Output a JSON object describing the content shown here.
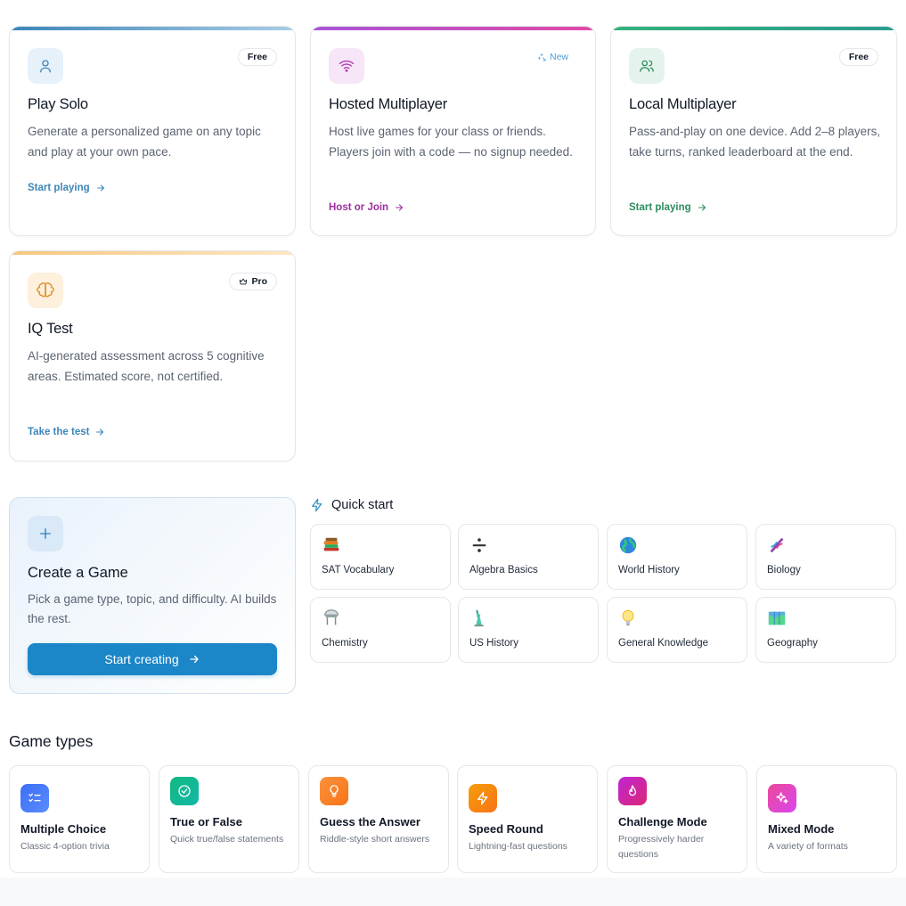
{
  "modes": [
    {
      "id": "play-solo",
      "title": "Play Solo",
      "badge": "Free",
      "desc": "Generate a personalized game on any topic and play at your own pace.",
      "link": "Start playing",
      "icon": "user-icon"
    },
    {
      "id": "hosted-multiplayer",
      "title": "Hosted Multiplayer",
      "badge": "New",
      "desc": "Host live games for your class or friends. Players join with a code — no signup needed.",
      "link": "Host or Join",
      "icon": "wifi-icon"
    },
    {
      "id": "local-multiplayer",
      "title": "Local Multiplayer",
      "badge": "Free",
      "desc": "Pass-and-play on one device. Add 2–8 players, take turns, ranked leaderboard at the end.",
      "link": "Start playing",
      "icon": "users-icon"
    },
    {
      "id": "iq-test",
      "title": "IQ Test",
      "badge": "Pro",
      "desc": "AI-generated assessment across 5 cognitive areas. Estimated score, not certified.",
      "link": "Take the test",
      "icon": "brain-icon"
    }
  ],
  "create": {
    "title": "Create a Game",
    "desc": "Pick a game type, topic, and difficulty. AI builds the rest.",
    "cta": "Start creating"
  },
  "quick_start": {
    "title": "Quick start",
    "items": [
      {
        "label": "SAT Vocabulary",
        "icon": "books-icon"
      },
      {
        "label": "Algebra Basics",
        "icon": "divide-icon"
      },
      {
        "label": "World History",
        "icon": "globe-icon"
      },
      {
        "label": "Biology",
        "icon": "dna-icon"
      },
      {
        "label": "Chemistry",
        "icon": "flask-icon"
      },
      {
        "label": "US History",
        "icon": "statue-of-liberty-icon"
      },
      {
        "label": "General Knowledge",
        "icon": "lightbulb-icon"
      },
      {
        "label": "Geography",
        "icon": "map-icon"
      }
    ]
  },
  "game_types": {
    "title": "Game types",
    "items": [
      {
        "name": "Multiple Choice",
        "sub": "Classic 4-option trivia",
        "icon": "list-check-icon",
        "color": "#3b6ef5"
      },
      {
        "name": "True or False",
        "sub": "Quick true/false statements",
        "icon": "check-circle-icon",
        "color": "#14b8a6"
      },
      {
        "name": "Guess the Answer",
        "sub": "Riddle-style short answers",
        "icon": "lightbulb-icon",
        "color": "#f97316"
      },
      {
        "name": "Speed Round",
        "sub": "Lightning-fast questions",
        "icon": "bolt-icon",
        "color": "#f5a524"
      },
      {
        "name": "Challenge Mode",
        "sub": "Progressively harder questions",
        "icon": "flame-icon",
        "color": "#d63ac0"
      },
      {
        "name": "Mixed Mode",
        "sub": "A variety of formats",
        "icon": "sparkles-icon",
        "color": "#ec4899"
      }
    ]
  },
  "colors": {
    "solo": "#3d86b8",
    "hosted": "#9b2f9e",
    "local": "#2f8d5c",
    "iq": "#3d86b8",
    "cta": "#1b86c8"
  }
}
